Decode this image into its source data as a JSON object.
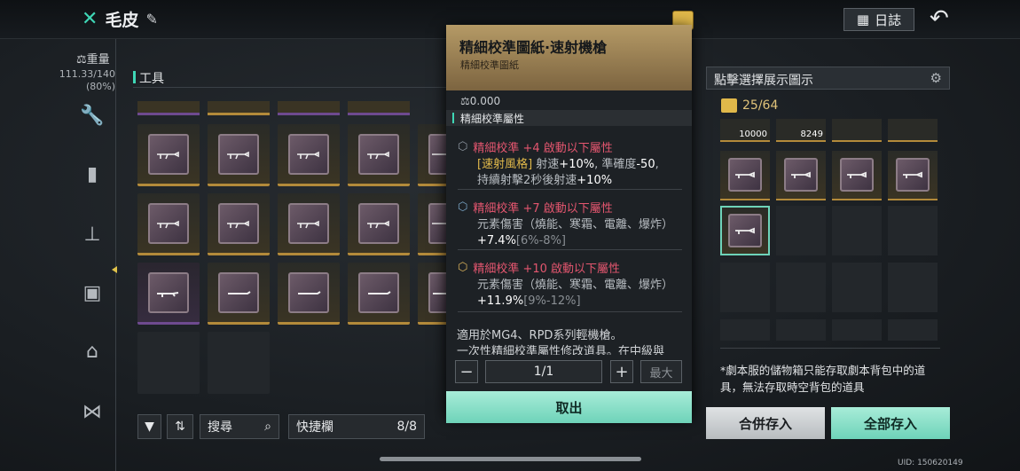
{
  "header": {
    "title": "毛皮",
    "log_label": "日誌"
  },
  "weight": {
    "label": "重量",
    "value": "111.33/140",
    "percent": "(80%)"
  },
  "section": {
    "title": "工具"
  },
  "toolbar": {
    "search_label": "搜尋",
    "quick_label": "快捷欄",
    "quick_count": "8/8"
  },
  "popup": {
    "title": "精細校準圖紙·速射機槍",
    "subtitle": "精細校準圖紙",
    "weight": "0.000",
    "attr_title": "精細校準屬性",
    "bonuses": [
      {
        "title": "精細校準 +4 啟動以下屬性",
        "lines": [
          "[速射風格] 射速+10%, 準確度-50,",
          "持續射擊2秒後射速+10%"
        ]
      },
      {
        "title": "精細校準 +7 啟動以下屬性",
        "lines": [
          "元素傷害（燒能、寒霜、電離、爆炸）",
          "+7.4%[6%-8%]"
        ]
      },
      {
        "title": "精細校準 +10 啟動以下屬性",
        "lines": [
          "元素傷害（燒能、寒霜、電離、爆炸）",
          "+11.9%[9%-12%]"
        ]
      }
    ],
    "description": [
      "適用於MG4、RPD系列輕機槍。",
      "一次性精細校準屬性修改道具。在中級與"
    ],
    "quantity": "1/1",
    "max_label": "最大",
    "takeout_label": "取出"
  },
  "right": {
    "header": "點擊選擇展示圖示",
    "capacity": "25/64",
    "counts": [
      "10000",
      "8249"
    ],
    "note": "*劇本服的儲物箱只能存取劇本背包中的道具，無法存取時空背包的道具",
    "merge_label": "合併存入",
    "all_label": "全部存入"
  },
  "uid": "UID: 150620149",
  "colors": {
    "accent": "#6ed3b9",
    "gold": "#b38a3a",
    "purple": "#6e4a8f",
    "bonus": "#e4566f"
  }
}
